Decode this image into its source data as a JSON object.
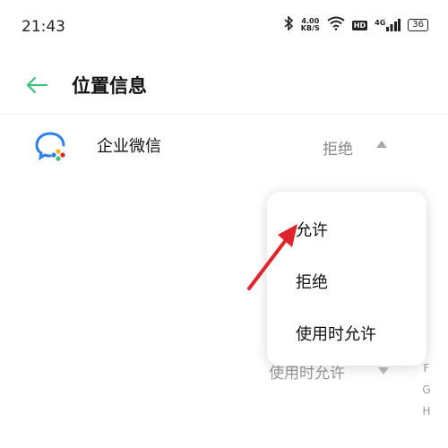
{
  "status_bar": {
    "time": "21:43",
    "speed_value": "4.00",
    "speed_unit": "KB/S",
    "hd": "HD",
    "network": "4G",
    "battery": "36"
  },
  "header": {
    "back_icon": "arrow-left-icon",
    "title": "位置信息"
  },
  "app_row": {
    "icon": "wecom-icon",
    "name": "企业微信",
    "permission": "拒绝"
  },
  "dropdown": {
    "options": [
      "允许",
      "拒绝",
      "使用时允许"
    ]
  },
  "ghost_row": {
    "permission": "使用时允许"
  },
  "index_letters": [
    "F",
    "G",
    "H"
  ],
  "colors": {
    "accent": "#3cbf7a",
    "annotation": "#e0242b",
    "wecom_blue": "#2e7fe8",
    "wecom_yellow": "#f4b400"
  }
}
